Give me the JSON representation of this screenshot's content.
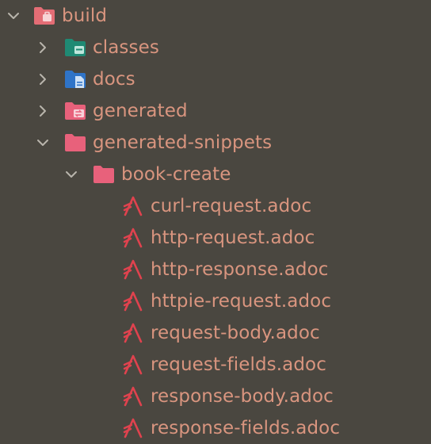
{
  "colors": {
    "background": "#4a4740",
    "label": "#d9957f",
    "chevron": "#b9b5ac",
    "folder_pink": "#e8617b",
    "folder_teal": "#1f8a74",
    "folder_blue": "#2f74c8",
    "folder_build": "#e46d75",
    "asciidoc_red": "#e0424e"
  },
  "tree": {
    "build": {
      "label": "build",
      "icon": "build-folder-icon",
      "state": "expanded"
    },
    "classes": {
      "label": "classes",
      "icon": "classes-folder-icon",
      "state": "collapsed"
    },
    "docs": {
      "label": "docs",
      "icon": "docs-folder-icon",
      "state": "collapsed"
    },
    "generated": {
      "label": "generated",
      "icon": "generated-folder-icon",
      "state": "collapsed"
    },
    "generated_snippets": {
      "label": "generated-snippets",
      "icon": "folder-icon",
      "state": "expanded"
    },
    "book_create": {
      "label": "book-create",
      "icon": "folder-icon",
      "state": "expanded"
    },
    "files": [
      {
        "label": "curl-request.adoc",
        "icon": "asciidoc-file-icon"
      },
      {
        "label": "http-request.adoc",
        "icon": "asciidoc-file-icon"
      },
      {
        "label": "http-response.adoc",
        "icon": "asciidoc-file-icon"
      },
      {
        "label": "httpie-request.adoc",
        "icon": "asciidoc-file-icon"
      },
      {
        "label": "request-body.adoc",
        "icon": "asciidoc-file-icon"
      },
      {
        "label": "request-fields.adoc",
        "icon": "asciidoc-file-icon"
      },
      {
        "label": "response-body.adoc",
        "icon": "asciidoc-file-icon"
      },
      {
        "label": "response-fields.adoc",
        "icon": "asciidoc-file-icon"
      }
    ]
  }
}
